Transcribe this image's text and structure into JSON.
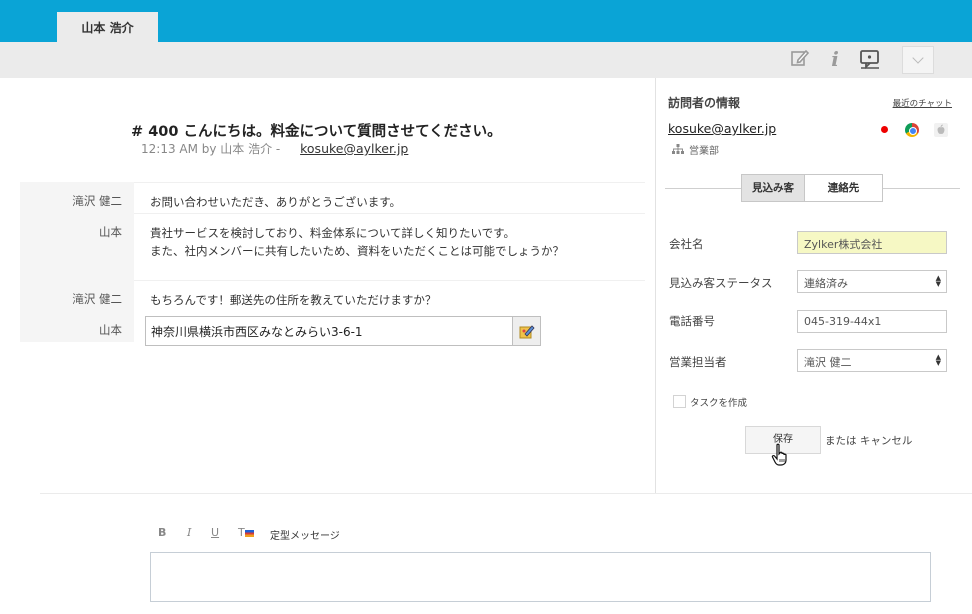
{
  "tab": {
    "visitor_name": "山本 浩介"
  },
  "toolbar": {
    "icons": [
      "edit-icon",
      "info-icon",
      "chat-transcript-icon",
      "chevron-down-icon"
    ]
  },
  "chat": {
    "title": "# 400 こんにちは。料金について質問させてください。",
    "meta": "12:13 AM by 山本 浩介 -",
    "email": "kosuke@aylker.jp",
    "messages": [
      {
        "sender": "滝沢 健二",
        "lines": [
          "お問い合わせいただき、ありがとうございます。"
        ]
      },
      {
        "sender": "山本",
        "lines": [
          "貴社サービスを検討しており、料金体系について詳しく知りたいです。",
          "また、社内メンバーに共有したいため、資料をいただくことは可能でしょうか？"
        ]
      },
      {
        "sender": "滝沢 健二",
        "lines": [
          "もちろんです！郵送先の住所を教えていただけますか？"
        ]
      },
      {
        "sender": "山本",
        "input_value": "神奈川県横浜市西区みなとみらい3-6-1"
      }
    ]
  },
  "visitor_info": {
    "title": "訪問者の情報",
    "recent_chats": "最近のチャット",
    "email": "kosuke@aylker.jp",
    "department": "営業部",
    "indicator_icons": [
      "japan-flag-icon",
      "chrome-icon",
      "apple-icon"
    ],
    "segments": {
      "active": "見込み客",
      "other": "連絡先"
    },
    "fields": {
      "company": {
        "label": "会社名",
        "value": "Zylker株式会社"
      },
      "status": {
        "label": "見込み客ステータス",
        "value": "連絡済み"
      },
      "phone": {
        "label": "電話番号",
        "value": "045-319-44x1"
      },
      "owner": {
        "label": "営業担当者",
        "value": "滝沢 健二"
      }
    },
    "create_task": "タスクを作成",
    "save": "保存",
    "or_cancel": "または キャンセル",
    "accent_color": "#0aa4d6",
    "highlight_color": "#f6f8c4"
  },
  "composer": {
    "bold": "B",
    "italic": "I",
    "underline": "U",
    "text_color": "T",
    "canned": "定型メッセージ"
  }
}
